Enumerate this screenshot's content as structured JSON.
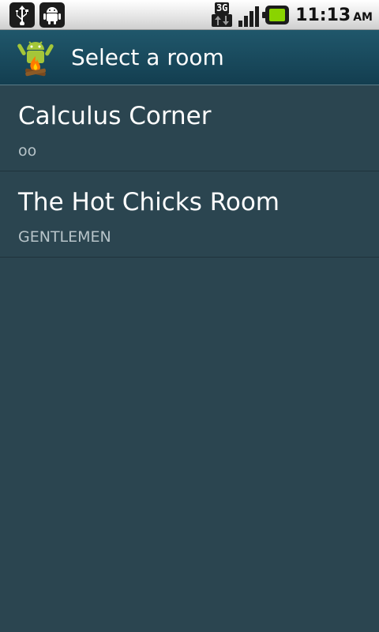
{
  "status_bar": {
    "notification_icons": [
      "usb-icon",
      "android-debug-icon"
    ],
    "network_label": "3G",
    "time": "11:13",
    "ampm": "AM",
    "colors": {
      "battery": "#8ad400"
    }
  },
  "titlebar": {
    "title": "Select a room",
    "app_icon": "android-campfire-icon"
  },
  "rooms": [
    {
      "name": "Calculus Corner",
      "topic": "oo"
    },
    {
      "name": "The Hot Chicks Room",
      "topic": "GENTLEMEN"
    }
  ],
  "colors": {
    "background": "#2b4550",
    "titlebar": "#1a4a5d"
  }
}
